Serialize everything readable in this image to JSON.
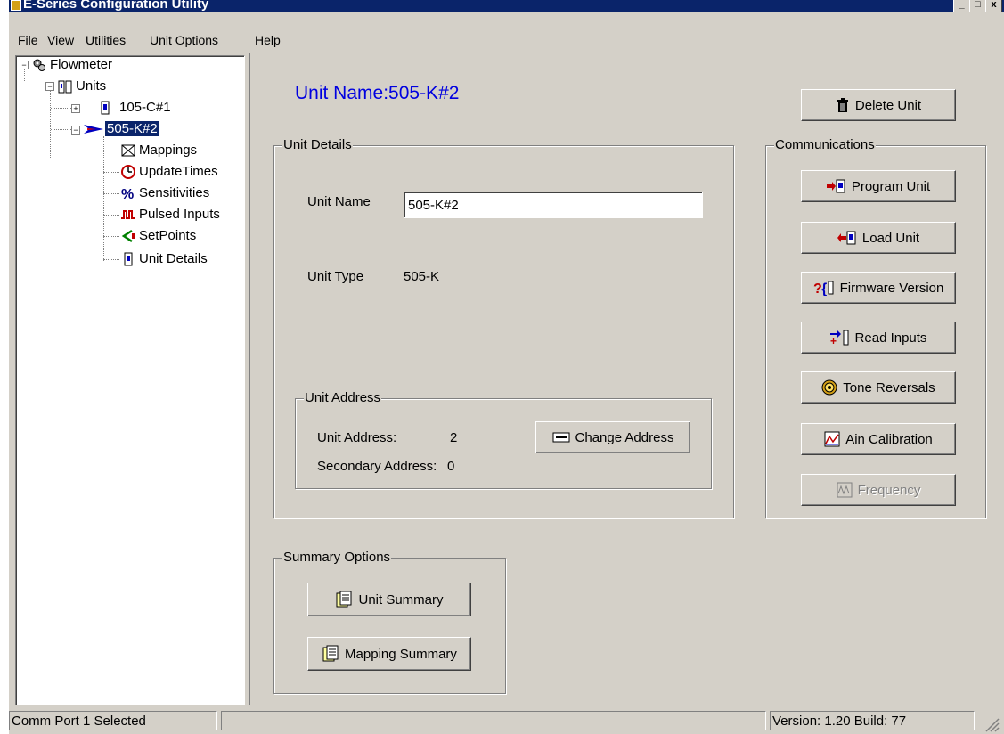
{
  "window": {
    "title": "E-Series Configuration Utility",
    "caption_buttons": [
      "_",
      "□",
      "x"
    ]
  },
  "menu": [
    "File",
    "View",
    "Utilities",
    "Unit Options",
    "Help"
  ],
  "tree": {
    "root": "Flowmeter",
    "units": "Units",
    "unit1": "105-C#1",
    "unit2": "505-K#2",
    "children": [
      "Mappings",
      "UpdateTimes",
      "Sensitivities",
      "Pulsed Inputs",
      "SetPoints",
      "Unit Details"
    ]
  },
  "heading": "Unit Name:505-K#2",
  "delete_button": "Delete Unit",
  "unit_details": {
    "group_title": "Unit Details",
    "name_label": "Unit Name",
    "name_value": "505-K#2",
    "type_label": "Unit Type",
    "type_value": "505-K"
  },
  "unit_address": {
    "group_title": "Unit Address",
    "address_label": "Unit Address:",
    "address_value": "2",
    "secondary_label": "Secondary Address:",
    "secondary_value": "0",
    "change_button": "Change Address"
  },
  "communications": {
    "group_title": "Communications",
    "program": "Program Unit",
    "load": "Load Unit",
    "firmware": "Firmware Version",
    "read_inputs": "Read Inputs",
    "tone": "Tone Reversals",
    "ain": "Ain Calibration",
    "frequency": "Frequency"
  },
  "summary": {
    "group_title": "Summary Options",
    "unit_summary": "Unit Summary",
    "mapping_summary": "Mapping Summary"
  },
  "status": {
    "left": "Comm Port 1 Selected",
    "middle": "",
    "right": "Version: 1.20 Build: 77"
  }
}
